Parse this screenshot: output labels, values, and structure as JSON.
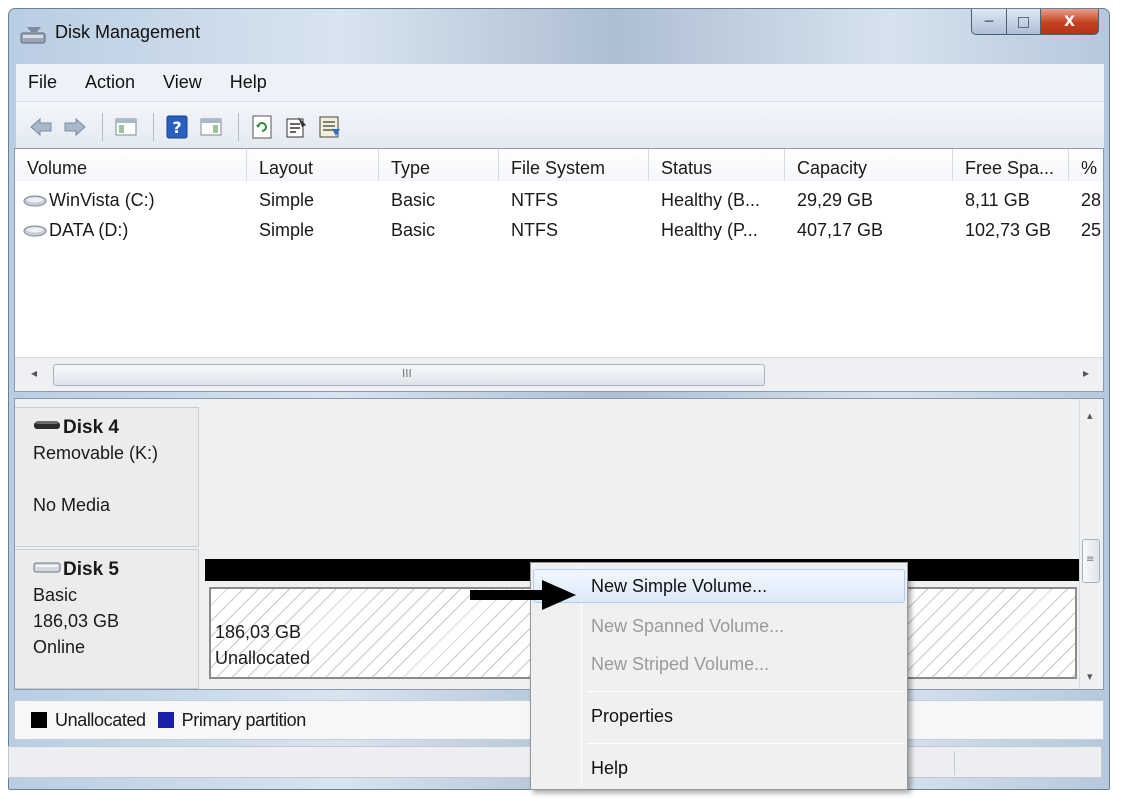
{
  "window": {
    "title": "Disk Management",
    "buttons": {
      "minimize": "─",
      "maximize": "□",
      "close": "X"
    }
  },
  "menu": [
    "File",
    "Action",
    "View",
    "Help"
  ],
  "toolbar": {
    "icons": [
      "back-arrow-icon",
      "forward-arrow-icon",
      "console-tree-icon",
      "help-icon",
      "action-pane-icon",
      "refresh-icon",
      "properties-icon",
      "export-list-icon"
    ]
  },
  "volume_list": {
    "columns": [
      "Volume",
      "Layout",
      "Type",
      "File System",
      "Status",
      "Capacity",
      "Free Spa...",
      "% F"
    ],
    "rows": [
      [
        "WinVista (C:)",
        "Simple",
        "Basic",
        "NTFS",
        "Healthy (B...",
        "29,29 GB",
        "8,11 GB",
        "28"
      ],
      [
        "DATA (D:)",
        "Simple",
        "Basic",
        "NTFS",
        "Healthy (P...",
        "407,17 GB",
        "102,73 GB",
        "25"
      ]
    ],
    "hscroll_grip": "III"
  },
  "disks": [
    {
      "name": "Disk 4",
      "lines": [
        "Removable (K:)",
        "",
        "No Media"
      ]
    },
    {
      "name": "Disk 5",
      "lines": [
        "Basic",
        "186,03 GB",
        "Online"
      ],
      "partition": {
        "size": "186,03 GB",
        "label": "Unallocated"
      }
    }
  ],
  "legend": [
    {
      "label": "Unallocated",
      "color": "#000000"
    },
    {
      "label": "Primary partition",
      "color": "#1a22a6"
    }
  ],
  "context_menu": {
    "items": [
      {
        "label": "New Simple Volume...",
        "enabled": true,
        "highlighted": true
      },
      {
        "label": "New Spanned Volume...",
        "enabled": false
      },
      {
        "label": "New Striped Volume...",
        "enabled": false
      },
      {
        "label": "Properties",
        "enabled": true
      },
      {
        "label": "Help",
        "enabled": true
      }
    ]
  }
}
